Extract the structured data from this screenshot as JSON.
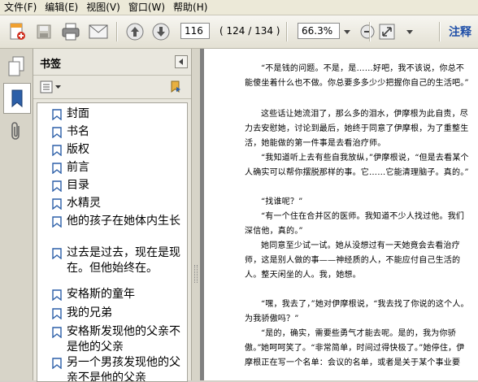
{
  "menu": [
    "文件(F)",
    "编辑(E)",
    "视图(V)",
    "窗口(W)",
    "帮助(H)"
  ],
  "toolbar": {
    "page_number": "116",
    "page_count": "( 124 / 134 )",
    "zoom": "66.3%",
    "comment_label": "注释"
  },
  "bookmarks": {
    "title": "书签",
    "items": [
      "封面",
      "书名",
      "版权",
      "前言",
      "目录",
      "水精灵",
      "他的孩子在她体内生长",
      "过去是过去，现在是现在。但他始终在。",
      "安格斯的童年",
      "我的兄弟",
      "安格斯发现他的父亲不是他的父亲",
      "另一个男孩发现他的父亲不是他的父亲"
    ]
  },
  "document": {
    "paragraphs": [
      "“不是钱的问题。不是，是……好吧，我不该说，你总不能傻坐着什么也不做。你总要多多少少把握你自己的生活吧。”",
      "这些话让她流泪了，那么多的泪水，伊摩根为此自责，尽力去安慰她，讨论到最后，她终于同意了伊摩根，为了重整生活，她能做的第一件事是去看治疗师。",
      "“我知道听上去有些自我放纵，”伊摩根说，“但是去看某个人确实可以帮你摆脱那样的事。它……它能清理脑子。真的。”",
      "“找谁呢？”",
      "“有一个住在合并区的医师。我知道不少人找过他。我们深信他，真的。”",
      "她同意至少试一试。她从没想过有一天她竟会去看治疗师，这是别人做的事——神经质的人，不能应付自己生活的人。整天闲坐的人。我，她想。",
      "“嘿，我去了，”她对伊摩根说，“我去找了你说的这个人。为我骄傲吗？”",
      "“是的，确实，需要些勇气才能去呢。是的，我为你骄傲。”",
      "她呵呵笑了。“非常简单，时间过得快极了。”她停住，伊摩根正在写一个名单：会议的名单，或者是关于某个事业要"
    ]
  },
  "colors": {
    "comment_accent": "#1f4fa8",
    "bookmark_icon": "#2c5fa8"
  }
}
